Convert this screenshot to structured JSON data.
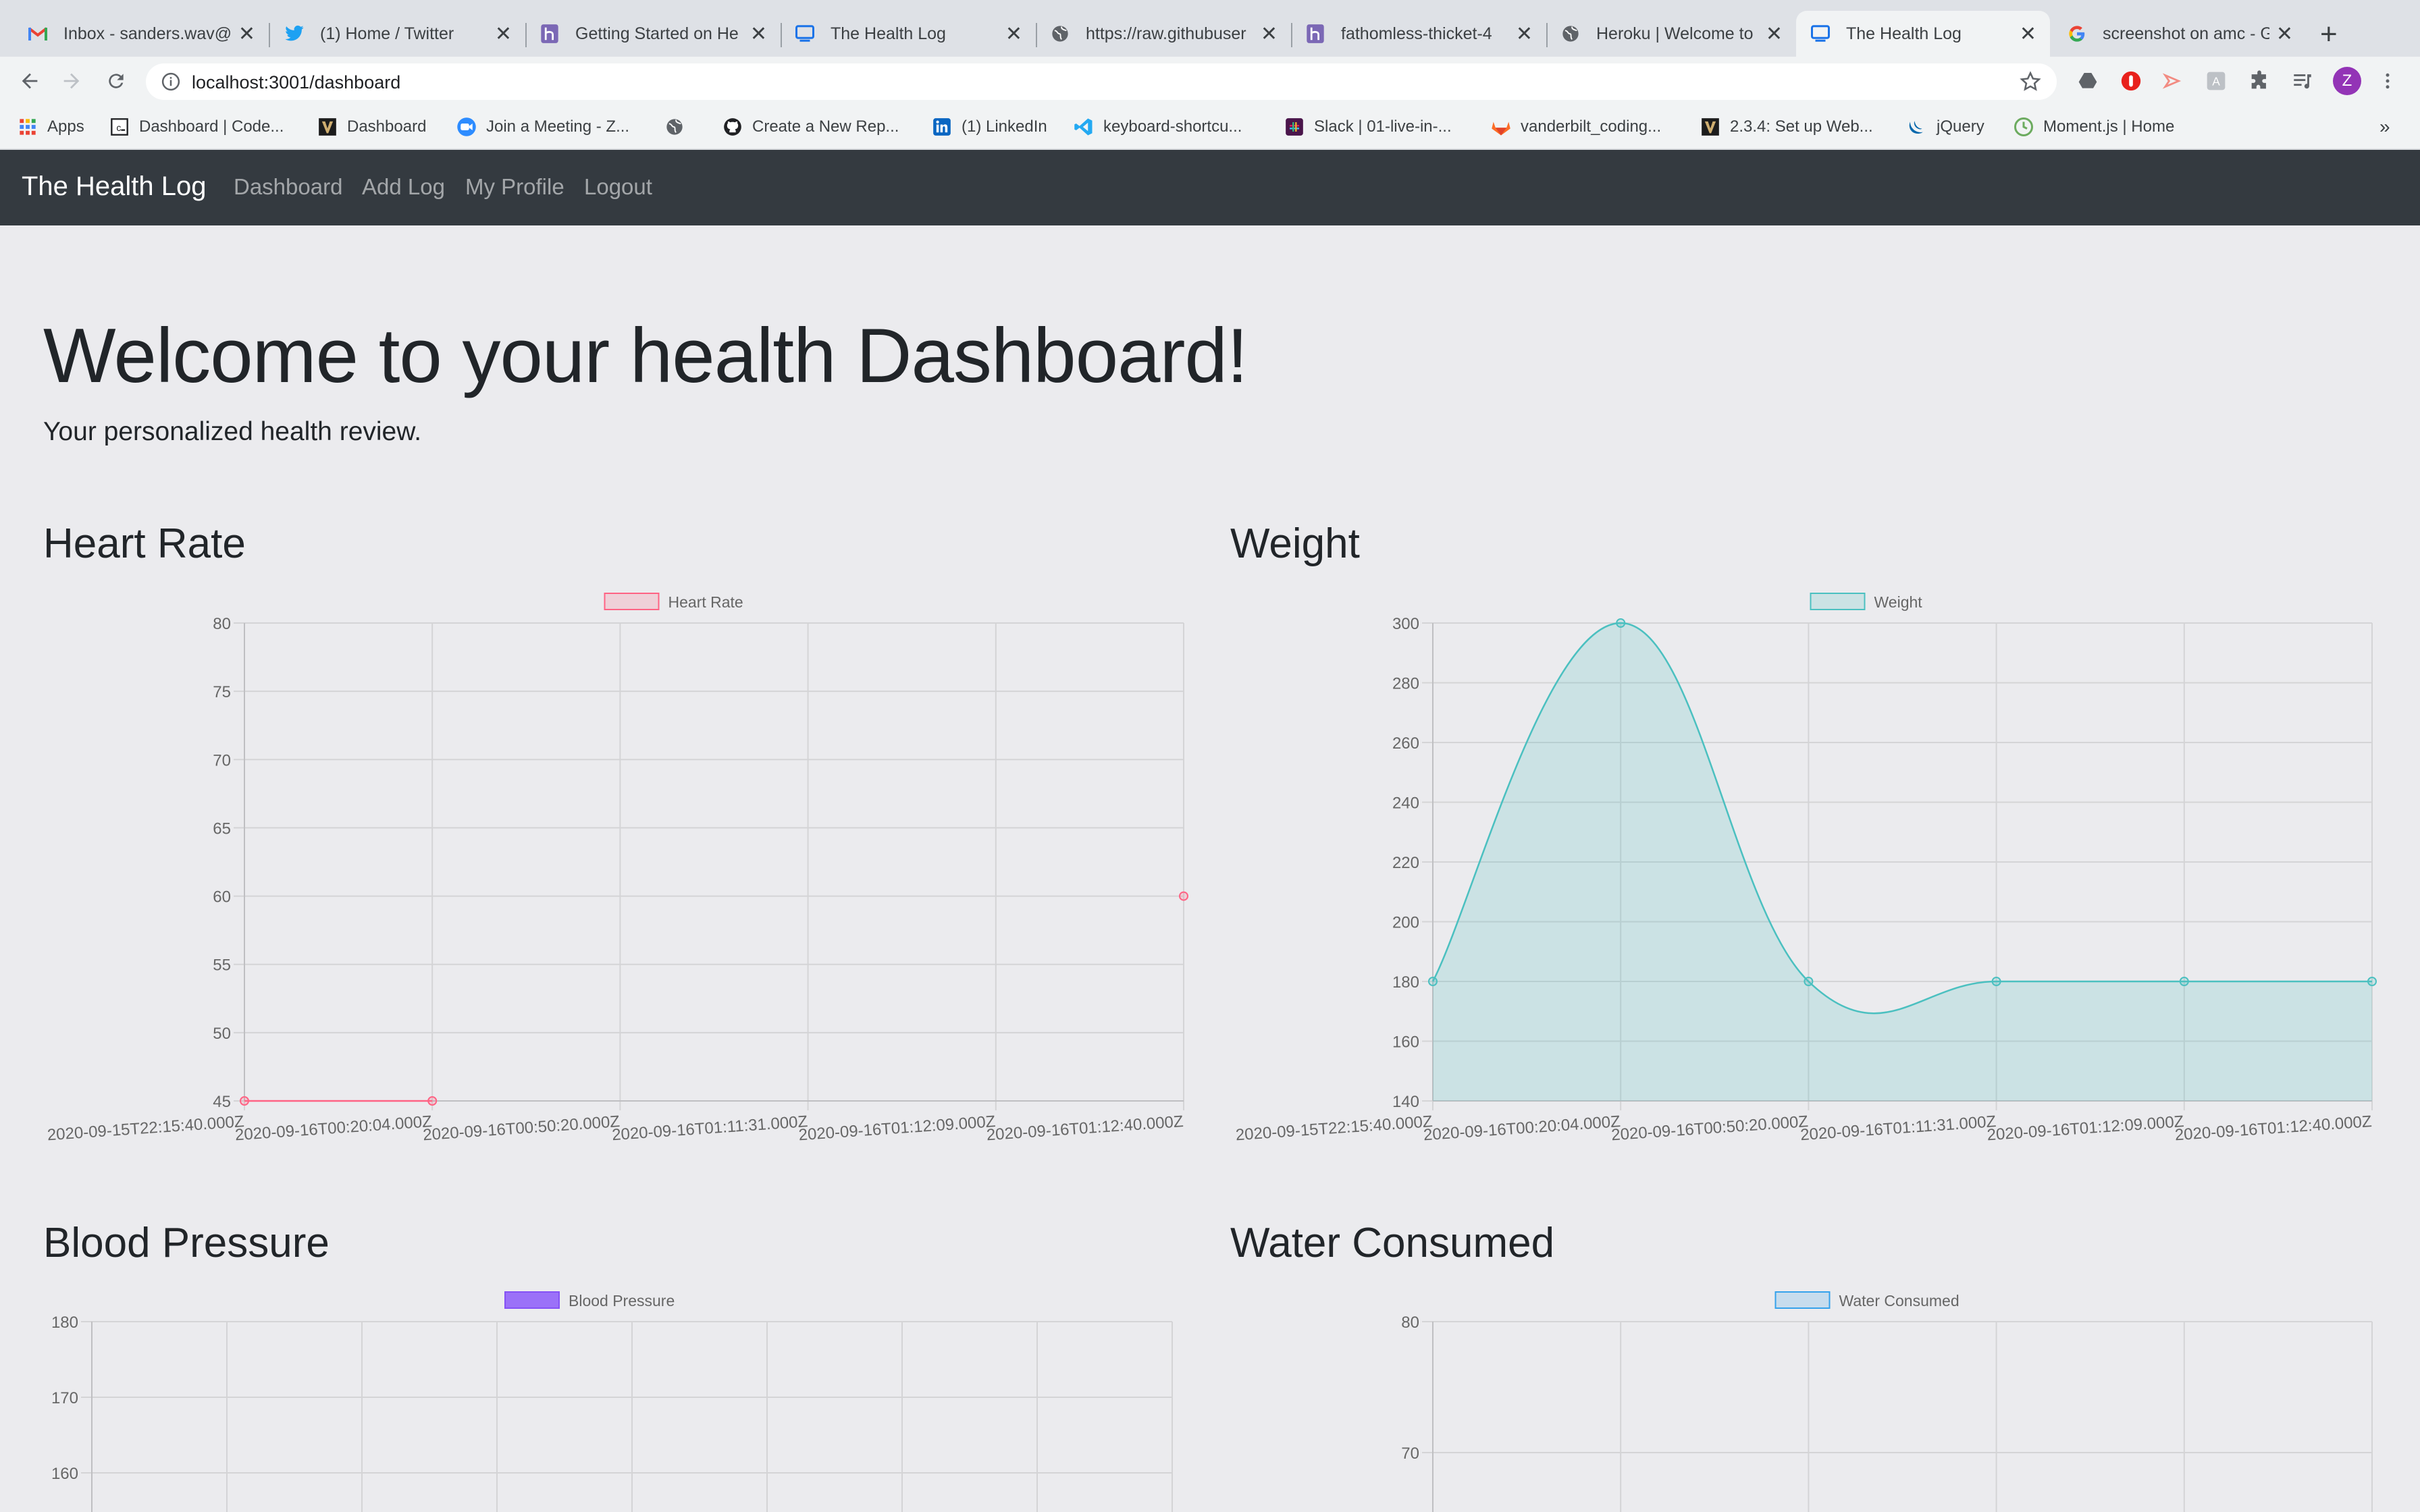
{
  "browser": {
    "tabs": [
      {
        "label": "Inbox - sanders.wav@",
        "icon": "gmail-icon"
      },
      {
        "label": "(1) Home / Twitter",
        "icon": "twitter-icon"
      },
      {
        "label": "Getting Started on He",
        "icon": "heroku-icon"
      },
      {
        "label": "The Health Log",
        "icon": "page-icon"
      },
      {
        "label": "https://raw.githubuser",
        "icon": "globe-icon"
      },
      {
        "label": "fathomless-thicket-4",
        "icon": "heroku-icon"
      },
      {
        "label": "Heroku | Welcome to",
        "icon": "globe-icon"
      },
      {
        "label": "The Health Log",
        "icon": "page-icon",
        "active": true
      },
      {
        "label": "screenshot on amc - G",
        "icon": "google-icon"
      }
    ],
    "url": "localhost:3001/dashboard",
    "profile_initial": "Z",
    "bookmarks": [
      {
        "label": "Apps",
        "icon": "apps-grid-icon"
      },
      {
        "label": "Dashboard | Code...",
        "icon": "codecademy-icon"
      },
      {
        "label": "Dashboard",
        "icon": "vanderbilt-icon"
      },
      {
        "label": "Join a Meeting - Z...",
        "icon": "zoom-icon"
      },
      {
        "label": "",
        "icon": "globe-icon"
      },
      {
        "label": "Create a New Rep...",
        "icon": "github-icon"
      },
      {
        "label": "(1) LinkedIn",
        "icon": "linkedin-icon"
      },
      {
        "label": "keyboard-shortcu...",
        "icon": "vscode-icon"
      },
      {
        "label": "Slack | 01-live-in-...",
        "icon": "slack-icon"
      },
      {
        "label": "vanderbilt_coding...",
        "icon": "gitlab-icon"
      },
      {
        "label": "2.3.4: Set up Web...",
        "icon": "vanderbilt-icon"
      },
      {
        "label": "jQuery",
        "icon": "jquery-icon"
      },
      {
        "label": "Moment.js | Home",
        "icon": "moment-icon"
      }
    ],
    "bookmarks_overflow": "»"
  },
  "nav": {
    "brand": "The Health Log",
    "links": [
      "Dashboard",
      "Add Log",
      "My Profile",
      "Logout"
    ]
  },
  "page": {
    "title": "Welcome to your health Dashboard!",
    "lead": "Your personalized health review."
  },
  "cards": [
    {
      "title": "Heart Rate"
    },
    {
      "title": "Weight"
    },
    {
      "title": "Blood Pressure"
    },
    {
      "title": "Water Consumed"
    }
  ],
  "colors": {
    "heart_line": "#ff6384",
    "heart_fill": "rgba(255,99,132,0.2)",
    "weight_line": "#4bc0c0",
    "weight_fill": "rgba(75,192,192,0.2)",
    "bp_line": "#8552f5",
    "bp_fill": "#9b71f8",
    "water_line": "#36a2eb",
    "water_fill": "rgba(54,162,235,0.2)"
  },
  "chart_data": [
    {
      "type": "line",
      "legend": "Heart Rate",
      "x": [
        "2020-09-15T22:15:40.000Z",
        "2020-09-16T00:20:04.000Z",
        "2020-09-16T00:50:20.000Z",
        "2020-09-16T01:11:31.000Z",
        "2020-09-16T01:12:09.000Z",
        "2020-09-16T01:12:40.000Z"
      ],
      "values": [
        45,
        45,
        null,
        null,
        null,
        60
      ],
      "ylim": [
        45,
        80
      ],
      "yticks": [
        80,
        75,
        70,
        65,
        60,
        55,
        50,
        45
      ],
      "grid": true,
      "fill": false,
      "legend_position": "top"
    },
    {
      "type": "area",
      "legend": "Weight",
      "x": [
        "2020-09-15T22:15:40.000Z",
        "2020-09-16T00:20:04.000Z",
        "2020-09-16T00:50:20.000Z",
        "2020-09-16T01:11:31.000Z",
        "2020-09-16T01:12:09.000Z",
        "2020-09-16T01:12:40.000Z"
      ],
      "values": [
        180,
        300,
        180,
        180,
        180,
        180
      ],
      "ylim": [
        140,
        300
      ],
      "yticks": [
        300,
        280,
        260,
        240,
        220,
        200,
        180,
        160,
        140
      ],
      "grid": true,
      "fill": true,
      "legend_position": "top"
    },
    {
      "type": "line",
      "legend": "Blood Pressure",
      "yticks_visible": [
        180,
        170,
        160
      ],
      "grid": true,
      "legend_position": "top"
    },
    {
      "type": "line",
      "legend": "Water Consumed",
      "yticks_visible": [
        80,
        70
      ],
      "grid": true,
      "legend_position": "top"
    }
  ]
}
